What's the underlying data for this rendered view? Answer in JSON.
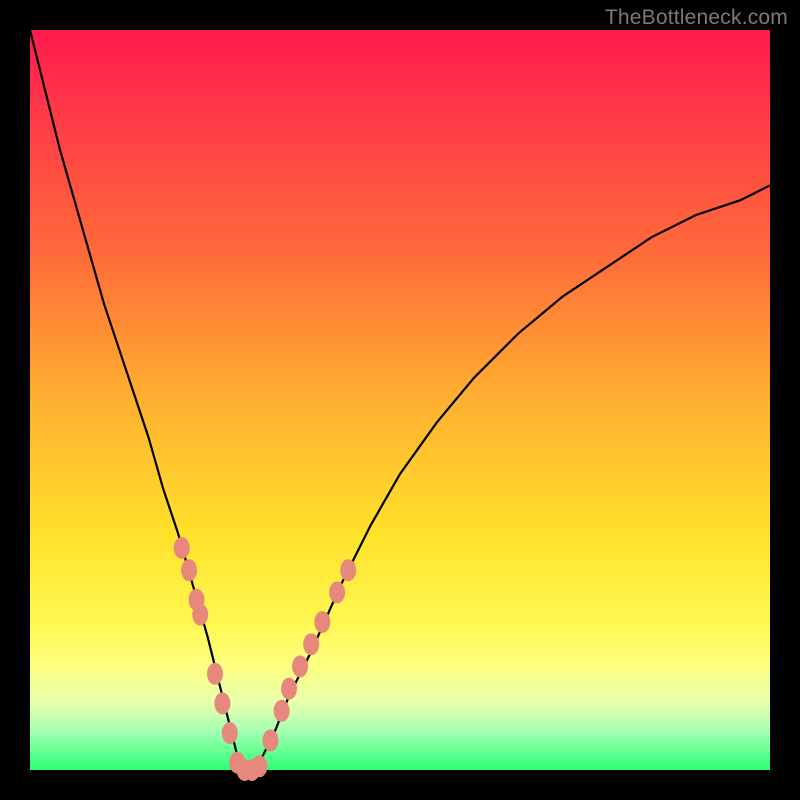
{
  "watermark": "TheBottleneck.com",
  "colors": {
    "frame": "#000000",
    "gradient_top": "#ff1a4d",
    "gradient_bottom": "#2cff74",
    "curve": "#000000",
    "dot": "#e7887c"
  },
  "chart_data": {
    "type": "line",
    "title": "",
    "xlabel": "",
    "ylabel": "",
    "xlim": [
      0,
      100
    ],
    "ylim": [
      0,
      100
    ],
    "x": [
      0,
      2,
      4,
      6,
      8,
      10,
      12,
      14,
      16,
      18,
      20,
      22,
      24,
      26,
      27,
      28,
      29,
      30,
      31,
      33,
      35,
      38,
      42,
      46,
      50,
      55,
      60,
      66,
      72,
      78,
      84,
      90,
      96,
      100
    ],
    "y": [
      100,
      92,
      84,
      77,
      70,
      63,
      57,
      51,
      45,
      38,
      32,
      25,
      18,
      10,
      6,
      2,
      0,
      0,
      1,
      5,
      10,
      16,
      25,
      33,
      40,
      47,
      53,
      59,
      64,
      68,
      72,
      75,
      77,
      79
    ],
    "annotations_along_curve": [
      {
        "x": 20.5,
        "y": 30
      },
      {
        "x": 21.5,
        "y": 27
      },
      {
        "x": 22.5,
        "y": 23
      },
      {
        "x": 23.0,
        "y": 21
      },
      {
        "x": 25.0,
        "y": 13
      },
      {
        "x": 26.0,
        "y": 9
      },
      {
        "x": 27.0,
        "y": 5
      },
      {
        "x": 28.0,
        "y": 1
      },
      {
        "x": 29.0,
        "y": 0
      },
      {
        "x": 30.0,
        "y": 0
      },
      {
        "x": 31.0,
        "y": 0.5
      },
      {
        "x": 32.5,
        "y": 4
      },
      {
        "x": 34.0,
        "y": 8
      },
      {
        "x": 35.0,
        "y": 11
      },
      {
        "x": 36.5,
        "y": 14
      },
      {
        "x": 38.0,
        "y": 17
      },
      {
        "x": 39.5,
        "y": 20
      },
      {
        "x": 41.5,
        "y": 24
      },
      {
        "x": 43.0,
        "y": 27
      }
    ]
  }
}
